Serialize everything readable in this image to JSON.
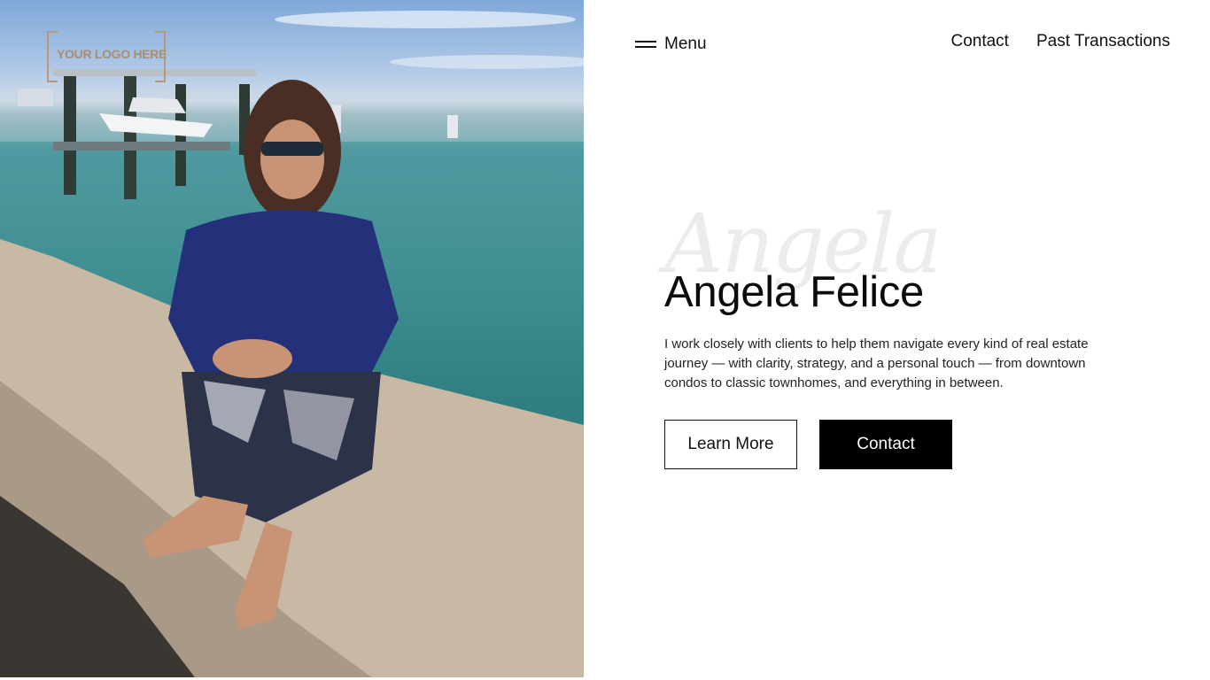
{
  "logo": {
    "text": "YOUR LOGO HERE"
  },
  "nav": {
    "menu_label": "Menu",
    "links": [
      "Contact",
      "Past Transactions"
    ]
  },
  "hero": {
    "script_name": "Angela",
    "name": "Angela Felice",
    "description": "I work closely with clients to help them navigate every kind of real estate journey — with clarity, strategy, and a personal touch — from downtown condos to classic townhomes, and everything in between.",
    "primary_button": "Learn More",
    "secondary_button": "Contact"
  },
  "colors": {
    "background": "#ffffff",
    "text": "#111111",
    "button_solid": "#000000",
    "script_watermark": "#ececec"
  }
}
